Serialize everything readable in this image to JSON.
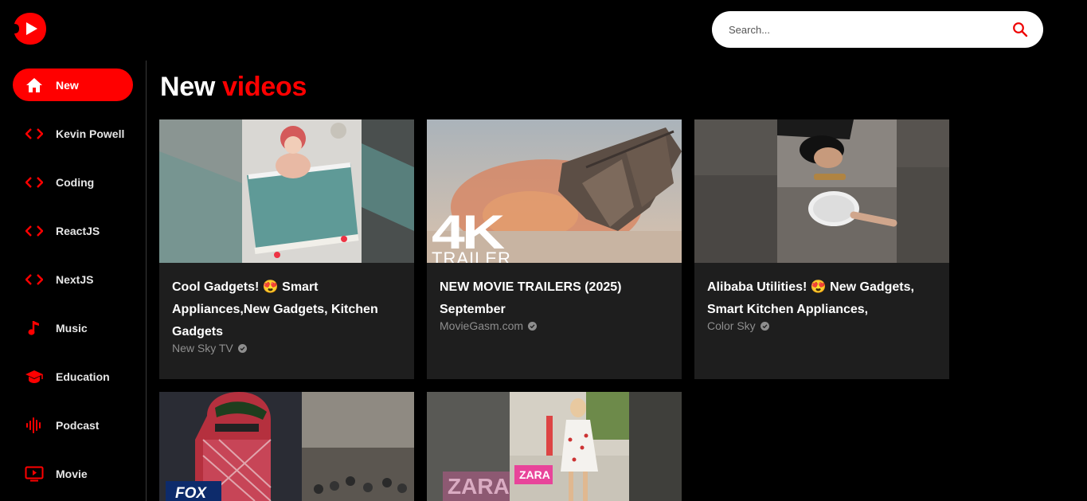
{
  "brand": {
    "accent": "#ff0000"
  },
  "search": {
    "placeholder": "Search..."
  },
  "sidebar": {
    "items": [
      {
        "label": "New",
        "icon": "home-icon",
        "active": true
      },
      {
        "label": "Kevin Powell",
        "icon": "code-icon"
      },
      {
        "label": "Coding",
        "icon": "code-icon"
      },
      {
        "label": "ReactJS",
        "icon": "code-icon"
      },
      {
        "label": "NextJS",
        "icon": "code-icon"
      },
      {
        "label": "Music",
        "icon": "music-note-icon"
      },
      {
        "label": "Education",
        "icon": "graduation-cap-icon"
      },
      {
        "label": "Podcast",
        "icon": "soundwave-icon"
      },
      {
        "label": "Movie",
        "icon": "tv-play-icon"
      }
    ]
  },
  "heading": {
    "word1": "New",
    "word2": "videos"
  },
  "videos": [
    {
      "title": "Cool Gadgets! 😍 Smart Appliances,New Gadgets, Kitchen Gadgets",
      "channel": "New Sky TV"
    },
    {
      "title": "NEW MOVIE TRAILERS (2025) September",
      "channel": "MovieGasm.com",
      "thumb_text_big": "4K",
      "thumb_text_small": "TRAILER"
    },
    {
      "title": "Alibaba Utilities! 😍 New Gadgets, Smart Kitchen Appliances,",
      "channel": "Color Sky"
    },
    {
      "title": "",
      "channel": "",
      "thumb_logo": "FOX"
    },
    {
      "title": "",
      "channel": "",
      "thumb_logo_1": "ZARA",
      "thumb_logo_2": "ZARA"
    }
  ]
}
